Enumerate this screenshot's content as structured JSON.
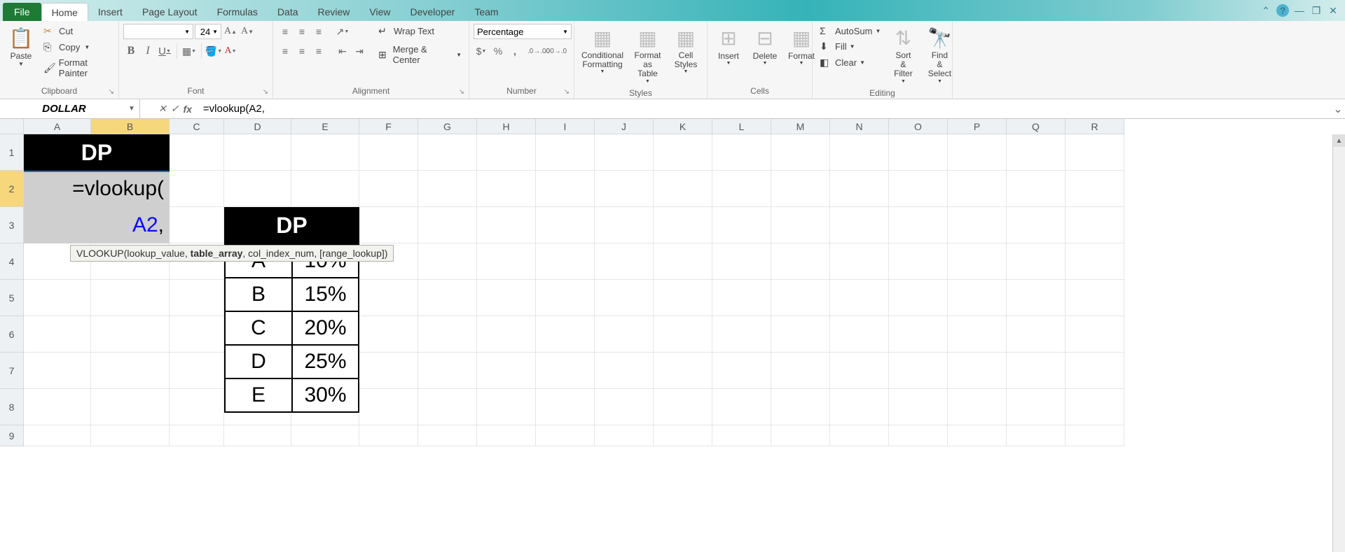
{
  "titlebar": {
    "tabs": {
      "file": "File",
      "home": "Home",
      "insert": "Insert",
      "page_layout": "Page Layout",
      "formulas": "Formulas",
      "data": "Data",
      "review": "Review",
      "view": "View",
      "developer": "Developer",
      "team": "Team"
    }
  },
  "ribbon": {
    "clipboard": {
      "paste": "Paste",
      "cut": "Cut",
      "copy": "Copy",
      "format_painter": "Format Painter",
      "label": "Clipboard"
    },
    "font": {
      "size": "24",
      "bold": "B",
      "italic": "I",
      "underline": "U",
      "label": "Font"
    },
    "alignment": {
      "wrap": "Wrap Text",
      "merge": "Merge & Center",
      "label": "Alignment"
    },
    "number": {
      "format": "Percentage",
      "dollar": "$",
      "percent": "%",
      "comma": ",",
      "label": "Number"
    },
    "styles": {
      "conditional": "Conditional Formatting",
      "table": "Format as Table",
      "cell": "Cell Styles",
      "label": "Styles"
    },
    "cells": {
      "insert": "Insert",
      "delete": "Delete",
      "format": "Format",
      "label": "Cells"
    },
    "editing": {
      "autosum": "AutoSum",
      "fill": "Fill",
      "clear": "Clear",
      "sort": "Sort & Filter",
      "find": "Find & Select",
      "label": "Editing"
    }
  },
  "formulabar": {
    "namebox": "DOLLAR",
    "formula": "=vlookup(A2,"
  },
  "columns": [
    "A",
    "B",
    "C",
    "D",
    "E",
    "F",
    "G",
    "H",
    "I",
    "J",
    "K",
    "L",
    "M",
    "N",
    "O",
    "P",
    "Q",
    "R"
  ],
  "rows": [
    "1",
    "2",
    "3",
    "4",
    "5",
    "6",
    "7",
    "8",
    "9"
  ],
  "sheet": {
    "header_b1": "DP",
    "editing_line1": "=vlookup(",
    "editing_ref": "A2",
    "editing_comma": ",",
    "header_de3": "DP",
    "lookup": [
      {
        "k": "A",
        "v": "10%"
      },
      {
        "k": "B",
        "v": "15%"
      },
      {
        "k": "C",
        "v": "20%"
      },
      {
        "k": "D",
        "v": "25%"
      },
      {
        "k": "E",
        "v": "30%"
      }
    ]
  },
  "tooltip": {
    "fn": "VLOOKUP",
    "p1": "lookup_value",
    "p2": "table_array",
    "p3": "col_index_num",
    "p4": "[range_lookup]"
  }
}
